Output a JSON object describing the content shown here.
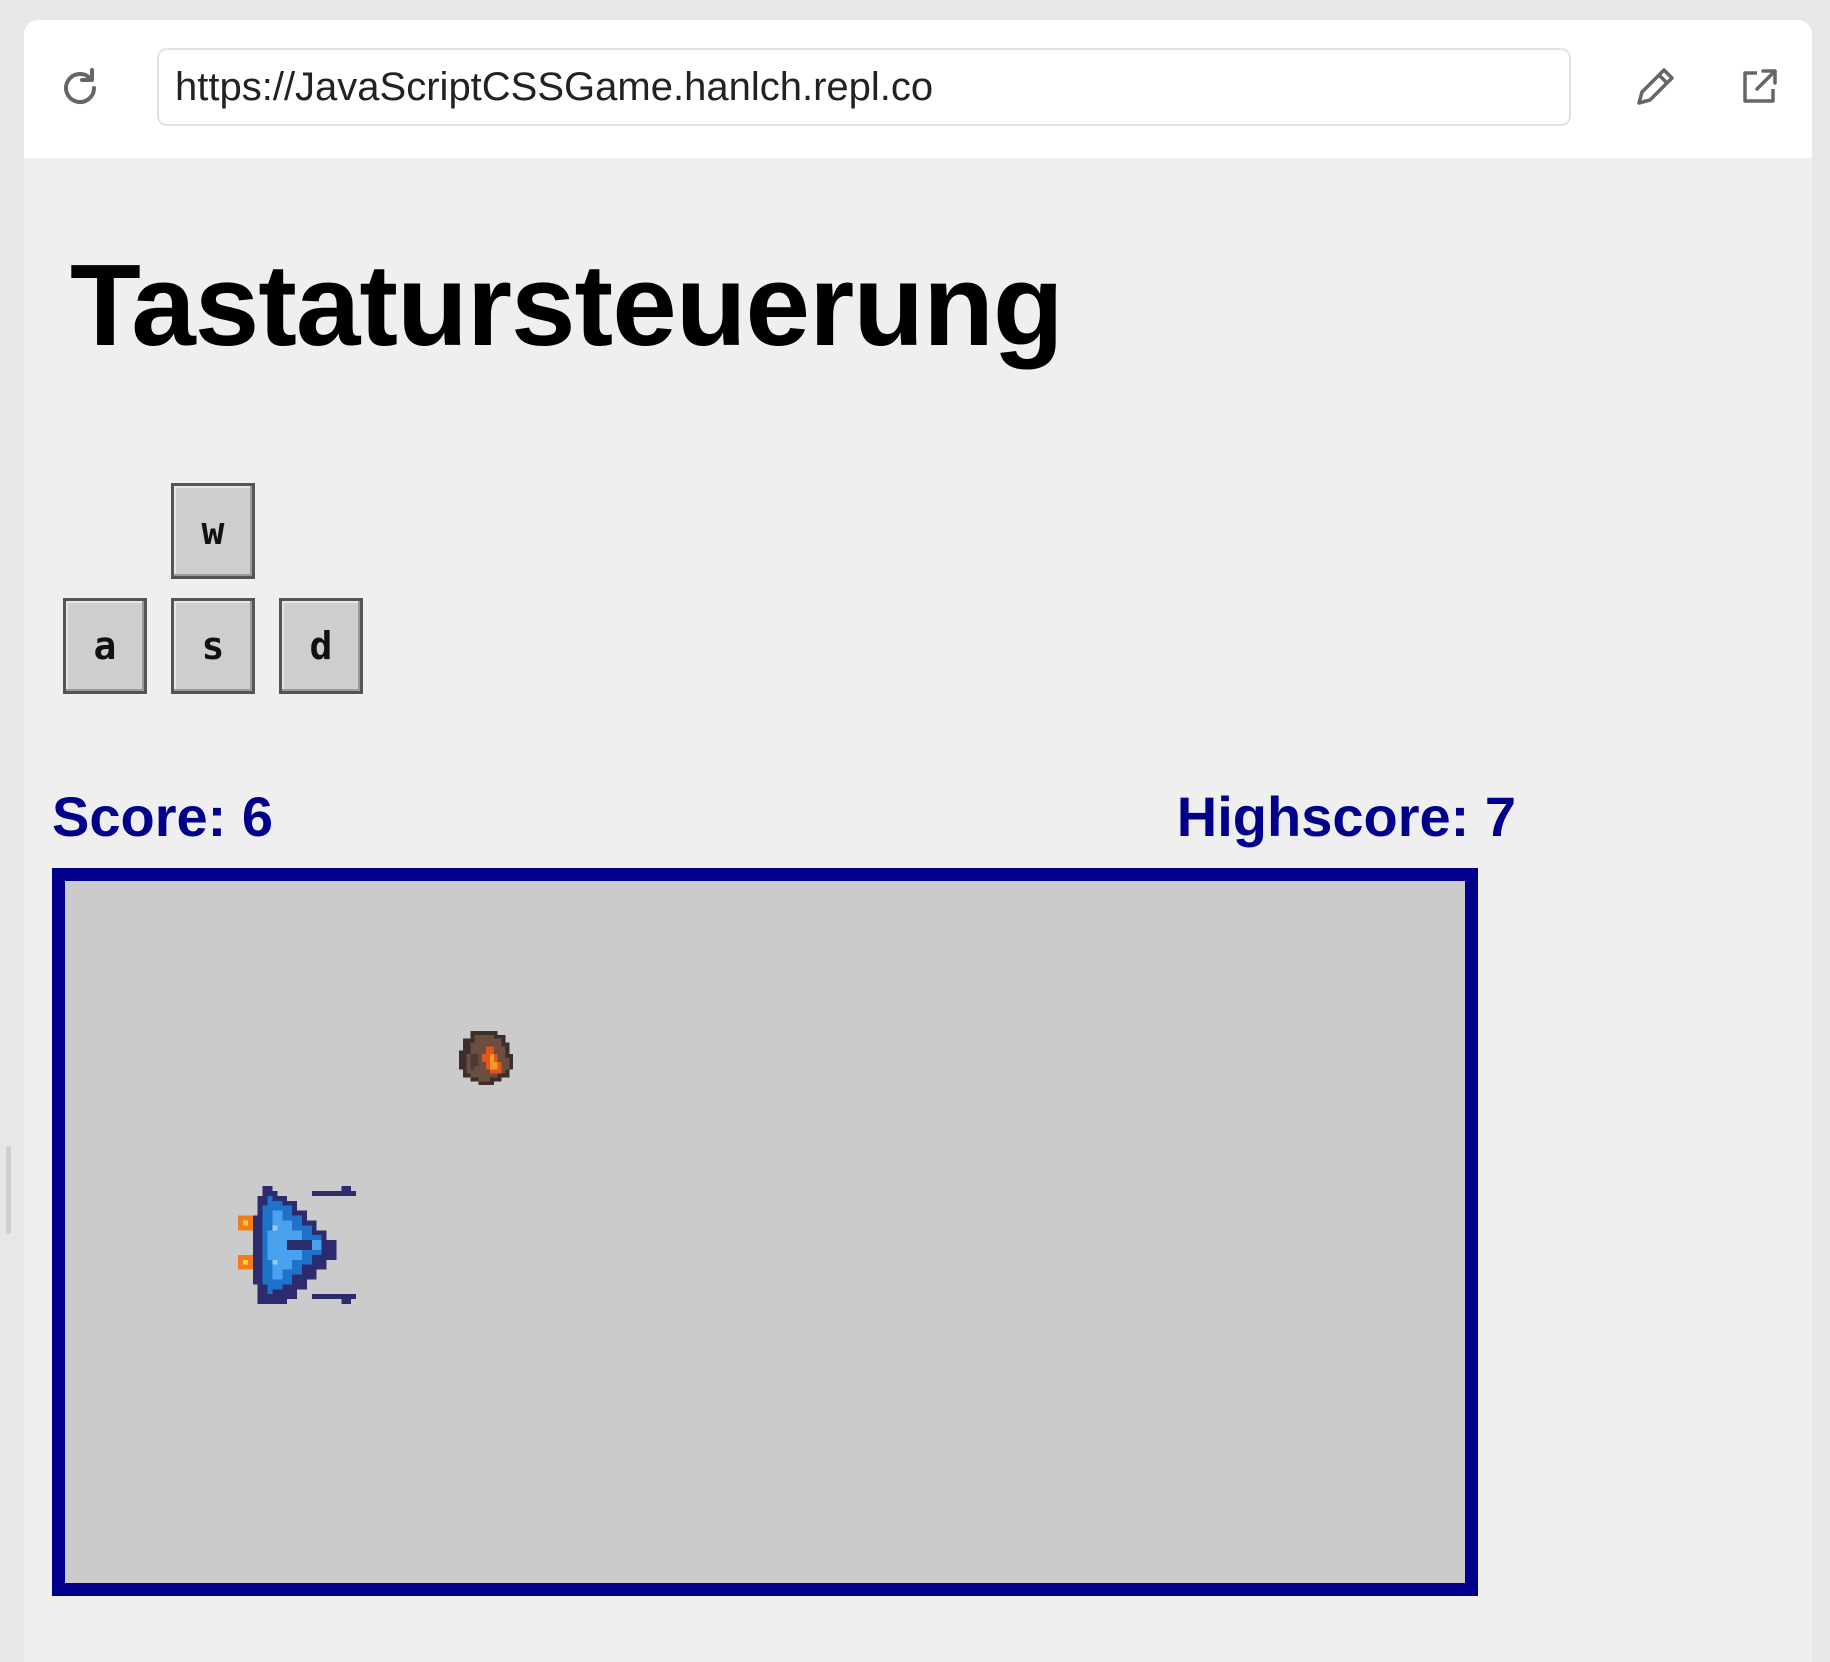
{
  "browser": {
    "url": "https://JavaScriptCSSGame.hanlch.repl.co",
    "icons": {
      "reload": "reload-icon",
      "edit": "pencil-icon",
      "external": "external-link-icon"
    }
  },
  "page": {
    "title": "Tastatursteuerung",
    "keys": {
      "w": "w",
      "a": "a",
      "s": "s",
      "d": "d"
    },
    "score_label": "Score:",
    "score_value": "6",
    "highscore_label": "Highscore:",
    "highscore_value": "7"
  },
  "colors": {
    "score_text": "#00008b",
    "arena_border": "#00008b",
    "arena_background": "#cbcbcb",
    "page_background": "#efefef"
  },
  "game": {
    "sprites": [
      "spaceship",
      "asteroid"
    ]
  }
}
